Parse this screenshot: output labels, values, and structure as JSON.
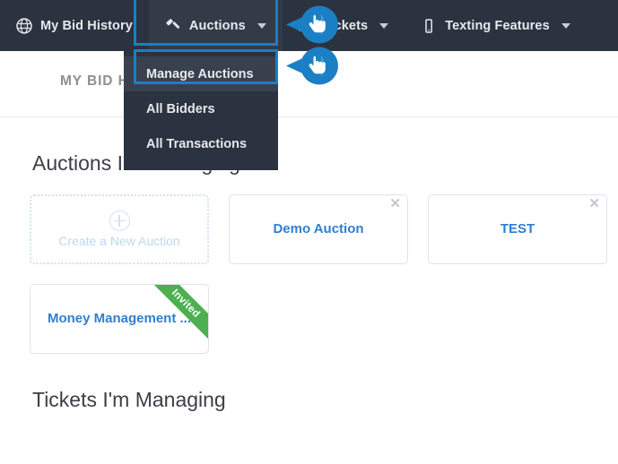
{
  "navbar": {
    "background": "#2b3240",
    "items": [
      {
        "label": "My Bid History",
        "icon": "globe-icon",
        "has_caret": false,
        "active": false
      },
      {
        "label": "Auctions",
        "icon": "gavel-icon",
        "has_caret": true,
        "active": true
      },
      {
        "label": "Tickets",
        "icon": "ticket-icon",
        "has_caret": true,
        "active": false
      },
      {
        "label": "Texting Features",
        "icon": "mobile-phone-icon",
        "has_caret": true,
        "active": false
      }
    ]
  },
  "dropdown": {
    "items": [
      {
        "label": "Manage Auctions",
        "highlighted": true
      },
      {
        "label": "All Bidders",
        "highlighted": false
      },
      {
        "label": "All Transactions",
        "highlighted": false
      }
    ]
  },
  "annotations": {
    "highlight_color": "#1b7fc4",
    "cursor_color": "#1b7fc4",
    "cursors": [
      {
        "name": "click-cursor-auctions"
      },
      {
        "name": "click-cursor-manage-auctions"
      }
    ]
  },
  "subheader": {
    "title": "MY BID HISTORY"
  },
  "sections": [
    {
      "title": "Auctions I'm Managing",
      "cards": [
        {
          "type": "create",
          "label": "Create a New Auction",
          "icon": "plus-circle-icon"
        },
        {
          "type": "auction",
          "title": "Demo Auction",
          "closable": true,
          "ribbon": null
        },
        {
          "type": "auction",
          "title": "TEST",
          "closable": true,
          "ribbon": null
        },
        {
          "type": "auction",
          "title": "Money Management ...",
          "closable": false,
          "ribbon": "Invited"
        }
      ]
    },
    {
      "title": "Tickets I'm Managing",
      "cards": []
    }
  ],
  "colors": {
    "nav_bg": "#2b3240",
    "nav_active_bg": "#333b49",
    "accent_blue": "#2f7fd1",
    "highlight_blue": "#1b7fc4",
    "ribbon_green": "#4caf50",
    "card_border": "#dfe3e8"
  }
}
